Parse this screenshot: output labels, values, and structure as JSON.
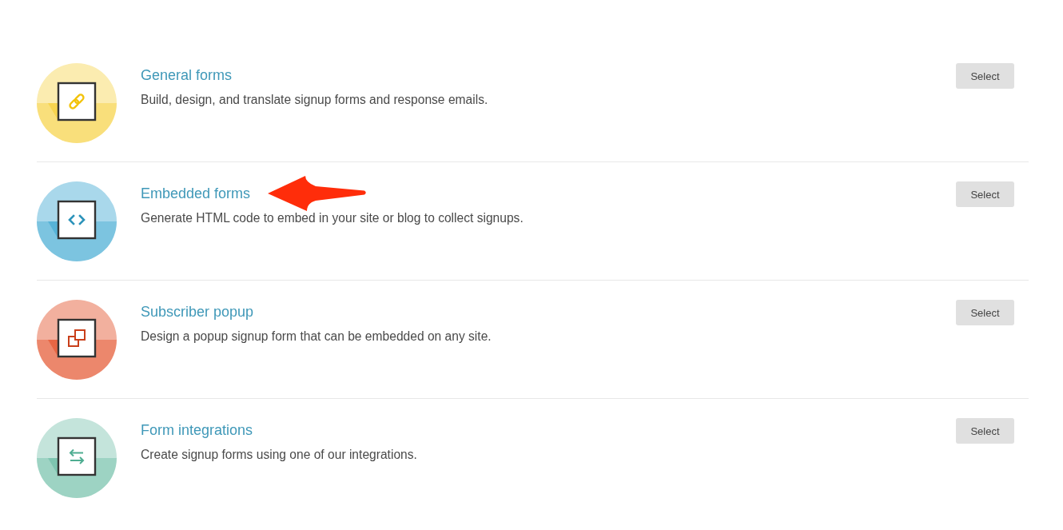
{
  "items": [
    {
      "kind": "link",
      "color": "#f9df7b",
      "title": "General forms",
      "description": "Build, design, and translate signup forms and response emails.",
      "button": "Select",
      "arrow": false
    },
    {
      "kind": "code",
      "color": "#7cc4e0",
      "title": "Embedded forms",
      "description": "Generate HTML code to embed in your site or blog to collect signups.",
      "button": "Select",
      "arrow": true
    },
    {
      "kind": "popup",
      "color": "#ec876c",
      "title": "Subscriber popup",
      "description": "Design a popup signup form that can be embedded on any site.",
      "button": "Select",
      "arrow": false
    },
    {
      "kind": "swap",
      "color": "#9dd3c3",
      "title": "Form integrations",
      "description": "Create signup forms using one of our integrations.",
      "button": "Select",
      "arrow": false
    }
  ]
}
